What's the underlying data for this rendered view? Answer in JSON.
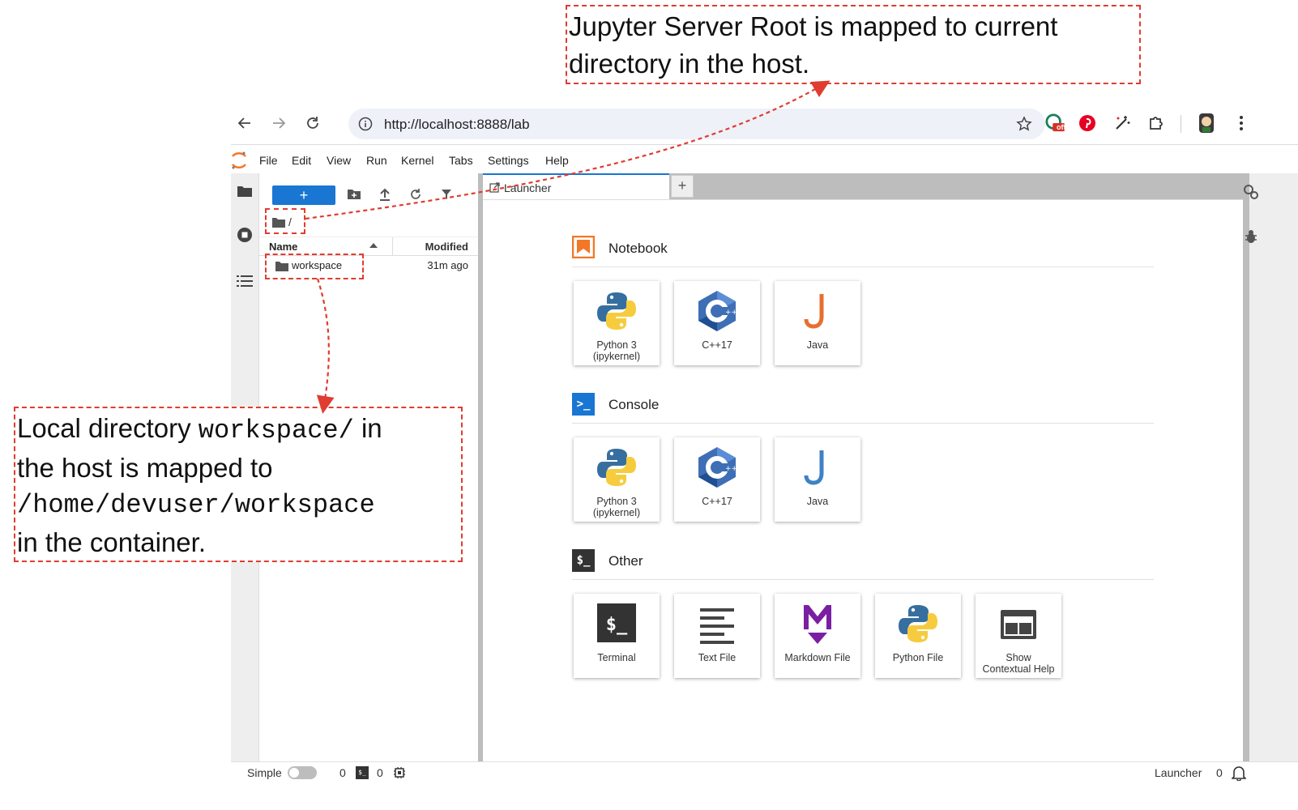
{
  "annotations": {
    "top": {
      "line1": "Jupyter Server Root is mapped to current",
      "line2": "directory in the host."
    },
    "bottom": {
      "line1_prefix": "Local directory ",
      "line1_code": "workspace/",
      "line1_suffix": " in",
      "line2": "the host is mapped to",
      "line3_code": "/home/devuser/workspace",
      "line4": "in the container."
    }
  },
  "browser": {
    "url": "http://localhost:8888/lab",
    "extension_badge": "off"
  },
  "menubar": {
    "items": [
      "File",
      "Edit",
      "View",
      "Run",
      "Kernel",
      "Tabs",
      "Settings",
      "Help"
    ]
  },
  "file_browser": {
    "new_label": "+",
    "breadcrumb": "/",
    "columns": {
      "name": "Name",
      "modified": "Modified"
    },
    "rows": [
      {
        "name": "workspace",
        "modified": "31m ago"
      }
    ]
  },
  "tabs": [
    {
      "label": "Launcher"
    }
  ],
  "tab_add_label": "+",
  "launcher": {
    "sections": [
      {
        "title": "Notebook",
        "cards": [
          {
            "label": "Python 3\n(ipykernel)"
          },
          {
            "label": "C++17"
          },
          {
            "label": "Java"
          }
        ]
      },
      {
        "title": "Console",
        "cards": [
          {
            "label": "Python 3\n(ipykernel)"
          },
          {
            "label": "C++17"
          },
          {
            "label": "Java"
          }
        ]
      },
      {
        "title": "Other",
        "cards": [
          {
            "label": "Terminal"
          },
          {
            "label": "Text File"
          },
          {
            "label": "Markdown File"
          },
          {
            "label": "Python File"
          },
          {
            "label": "Show\nContextual Help"
          }
        ]
      }
    ],
    "console_icon_text": ">_",
    "other_icon_text": "$_",
    "terminal_icon_text": "$_"
  },
  "status_bar": {
    "mode": "Simple",
    "terminals_count": "0",
    "kernels_count": "0",
    "terminal_icon_text": "$_",
    "active_label": "Launcher",
    "notifications_count": "0"
  },
  "colors": {
    "accent": "#1976d2",
    "annotation": "#e03c31",
    "notebook": "#f37726",
    "python_blue": "#366f9f",
    "python_yellow": "#f6cc3e",
    "java_orange": "#e76f2f",
    "java_blue": "#3e82c4",
    "markdown": "#7b1fa2"
  }
}
